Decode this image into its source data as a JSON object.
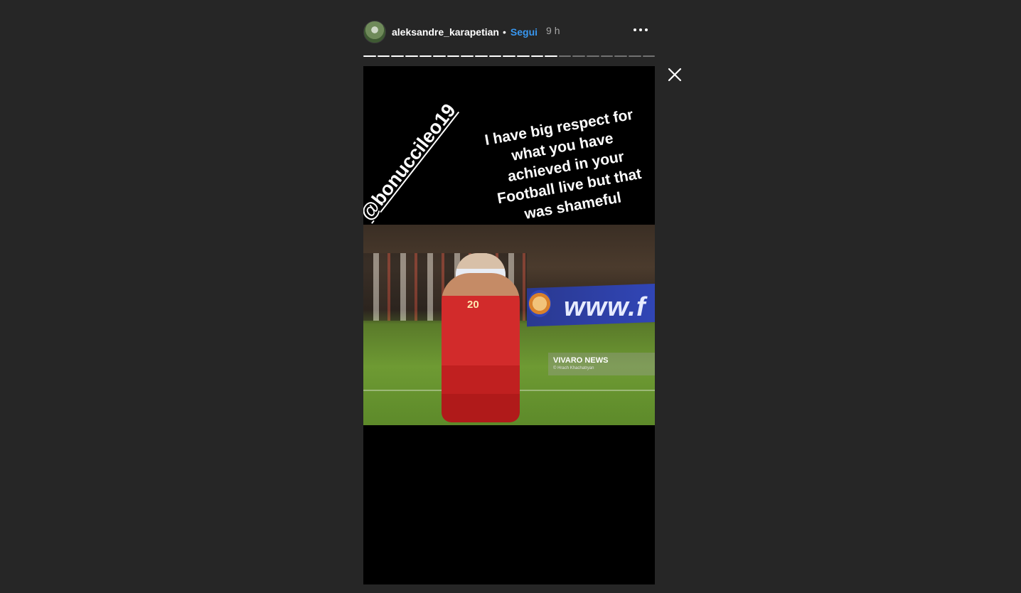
{
  "header": {
    "username": "aleksandre_karapetian",
    "separator": "•",
    "follow_label": "Segui",
    "time": "9 h",
    "avatar_icon": "avatar-photo",
    "more_icon": "more-options-icon"
  },
  "progress": {
    "total_segments": 21,
    "completed_segments": 14
  },
  "close_icon": "close-icon",
  "story": {
    "caption": "I have big respect for what you have achieved in your Football live but that was shameful",
    "mention": "@bonuccileo19",
    "photo": {
      "banner_text": "www.f",
      "jersey_number": "20",
      "watermark_name": "VIVARO NEWS",
      "watermark_credit": "© Hrach Khachatryan"
    }
  },
  "colors": {
    "background": "#262626",
    "follow_link": "#3897f0",
    "story_background": "#000000"
  }
}
